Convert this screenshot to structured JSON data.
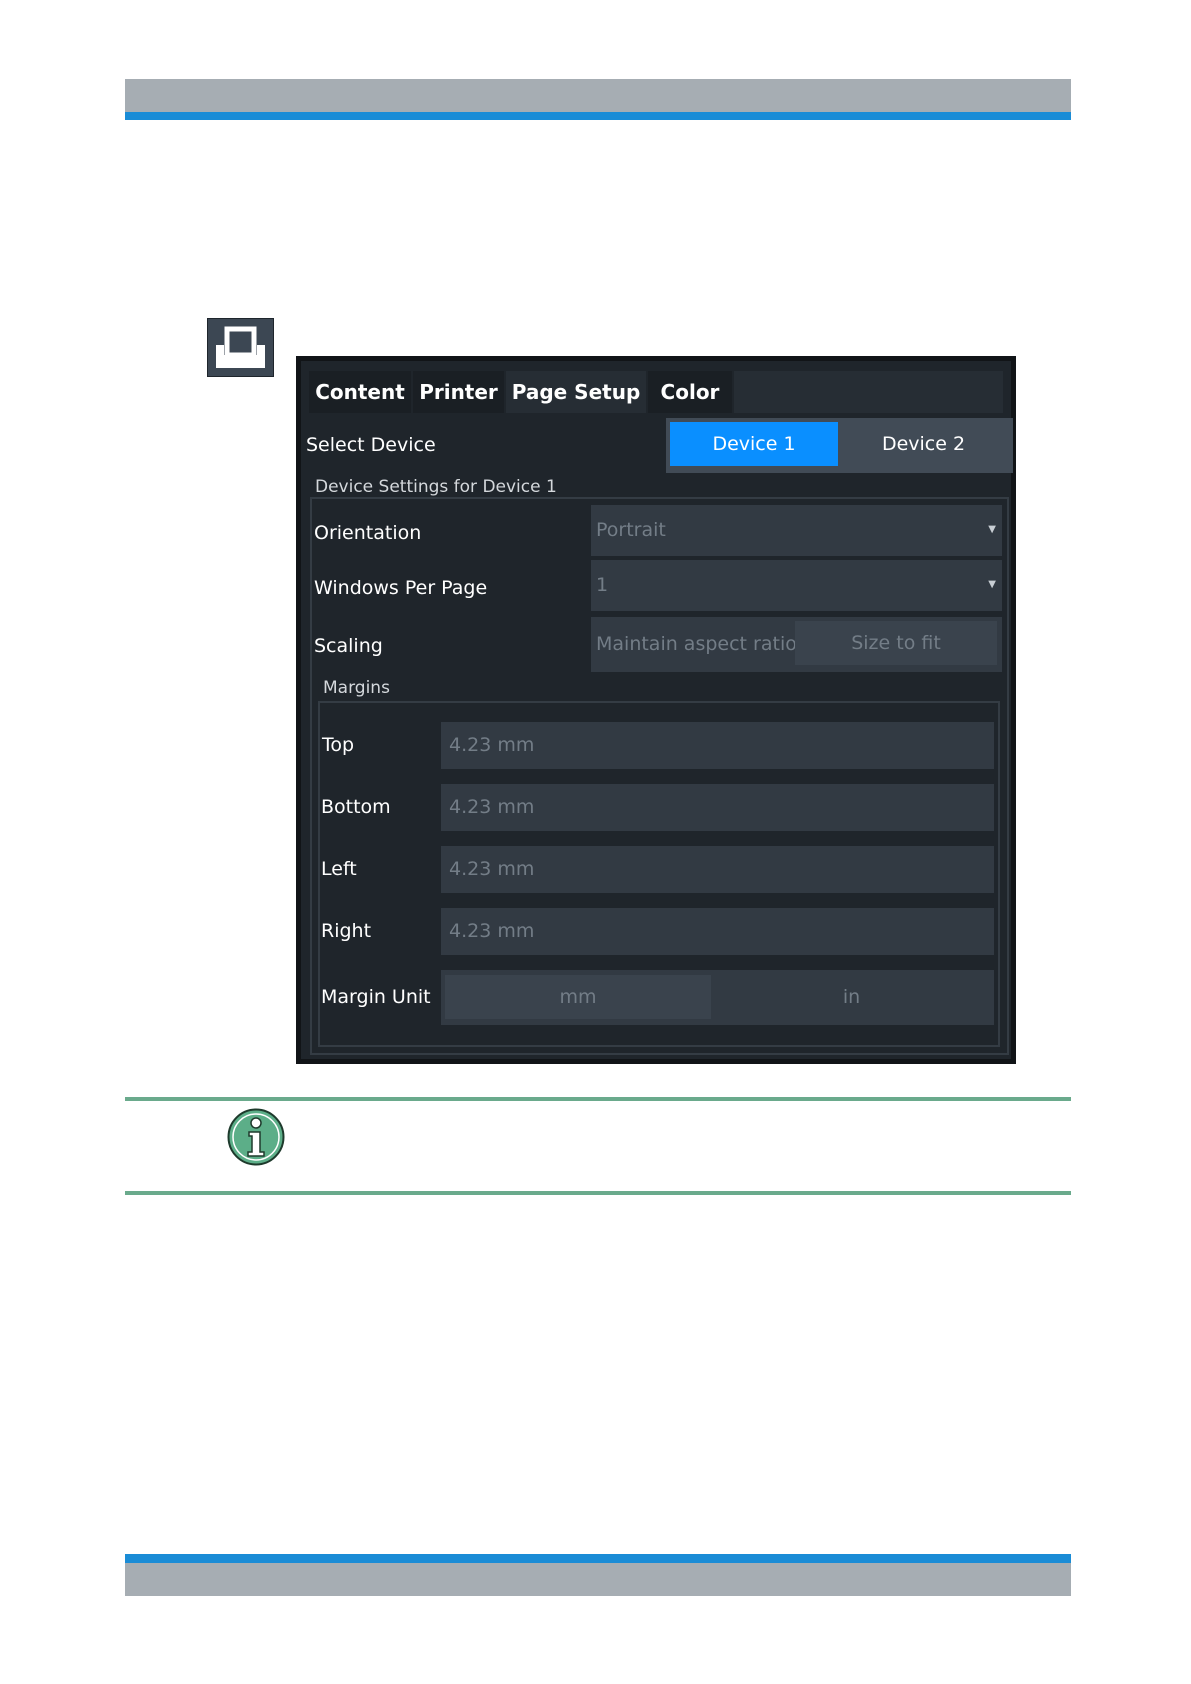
{
  "dialog": {
    "tabs": [
      {
        "label": "Content",
        "active": false
      },
      {
        "label": "Printer",
        "active": false
      },
      {
        "label": "Page Setup",
        "active": true
      },
      {
        "label": "Color",
        "active": false
      }
    ],
    "select_device": {
      "label": "Select Device",
      "options": [
        "Device 1",
        "Device 2"
      ],
      "selected": "Device 1"
    },
    "device_settings": {
      "group_title": "Device Settings for Device 1",
      "orientation": {
        "label": "Orientation",
        "value": "Portrait"
      },
      "windows_per_page": {
        "label": "Windows Per Page",
        "value": "1"
      },
      "scaling": {
        "label": "Scaling",
        "options": [
          "Maintain aspect ratio",
          "Size to fit"
        ]
      },
      "margins": {
        "group_title": "Margins",
        "top": {
          "label": "Top",
          "value": "4.23 mm"
        },
        "bottom": {
          "label": "Bottom",
          "value": "4.23 mm"
        },
        "left": {
          "label": "Left",
          "value": "4.23 mm"
        },
        "right": {
          "label": "Right",
          "value": "4.23 mm"
        },
        "unit": {
          "label": "Margin Unit",
          "options": [
            "mm",
            "in"
          ],
          "selected": "mm"
        }
      }
    }
  },
  "icons": {
    "print_icon": "printer-icon",
    "info_icon": "info-icon"
  },
  "colors": {
    "accent_blue": "#0a8fff",
    "header_bar": "#1a8cd6",
    "note_line": "#6aaa8c"
  }
}
